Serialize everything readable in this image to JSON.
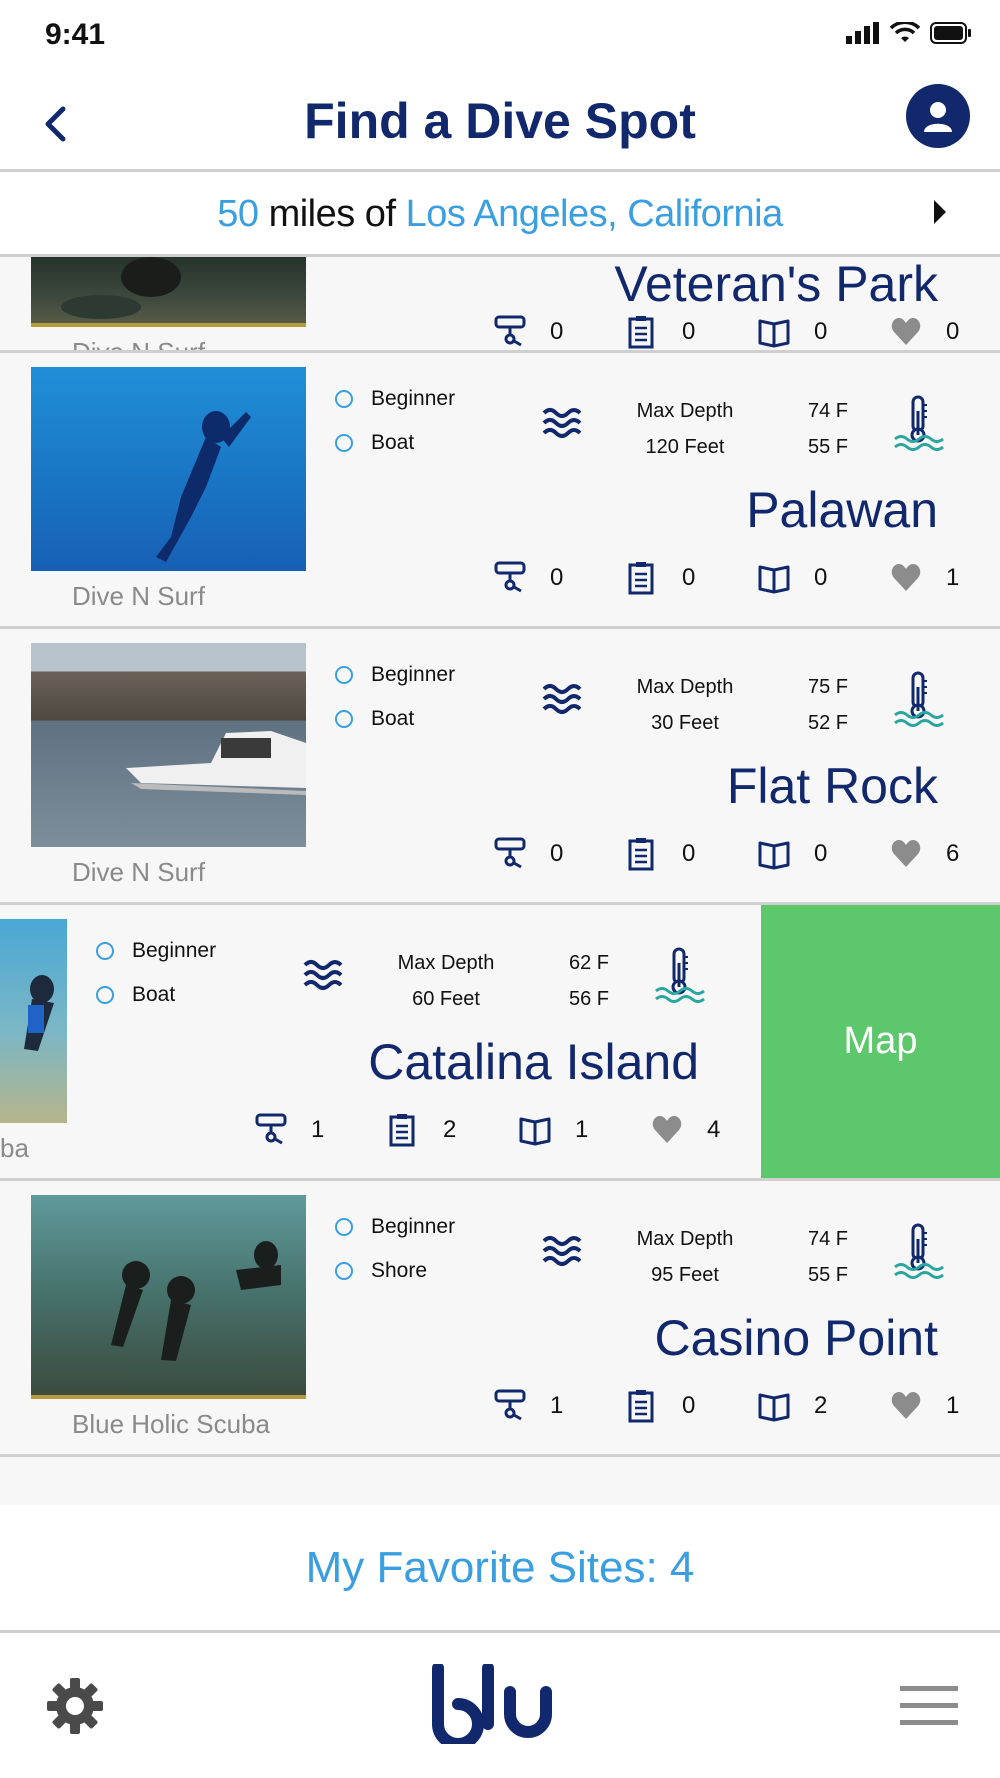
{
  "status_bar": {
    "time": "9:41"
  },
  "header": {
    "title": "Find a Dive Spot"
  },
  "location": {
    "radius": "50",
    "middle": " miles of ",
    "place": "Los Angeles, California"
  },
  "colors": {
    "navy": "#12286d",
    "accent_blue": "#3a9fe0",
    "map_green": "#5dc76b"
  },
  "sites": [
    {
      "name": "Veteran's Park",
      "shop": "Dive N Surf",
      "stats": {
        "dive": "0",
        "log": "0",
        "book": "0",
        "fav": "0"
      }
    },
    {
      "name": "Palawan",
      "shop": "Dive N Surf",
      "level": "Beginner",
      "access": "Boat",
      "depth_label": "Max Depth",
      "depth": "120 Feet",
      "temp_high": "74 F",
      "temp_low": "55 F",
      "stats": {
        "dive": "0",
        "log": "0",
        "book": "0",
        "fav": "1"
      }
    },
    {
      "name": "Flat Rock",
      "shop": "Dive N Surf",
      "level": "Beginner",
      "access": "Boat",
      "depth_label": "Max Depth",
      "depth": "30 Feet",
      "temp_high": "75 F",
      "temp_low": "52 F",
      "stats": {
        "dive": "0",
        "log": "0",
        "book": "0",
        "fav": "6"
      }
    },
    {
      "name": "Catalina Island",
      "shop": "ba",
      "level": "Beginner",
      "access": "Boat",
      "depth_label": "Max Depth",
      "depth": "60 Feet",
      "temp_high": "62 F",
      "temp_low": "56 F",
      "stats": {
        "dive": "1",
        "log": "2",
        "book": "1",
        "fav": "4"
      },
      "swipe_action": "Map"
    },
    {
      "name": "Casino Point",
      "shop": "Blue Holic Scuba",
      "level": "Beginner",
      "access": "Shore",
      "depth_label": "Max Depth",
      "depth": "95 Feet",
      "temp_high": "74 F",
      "temp_low": "55 F",
      "stats": {
        "dive": "1",
        "log": "0",
        "book": "2",
        "fav": "1"
      }
    }
  ],
  "favorites": {
    "label": "My Favorite Sites: 4"
  },
  "bottom_bar": {
    "logo_text": "blu",
    "settings_icon": "gear-icon",
    "menu_icon": "hamburger-menu-icon"
  }
}
